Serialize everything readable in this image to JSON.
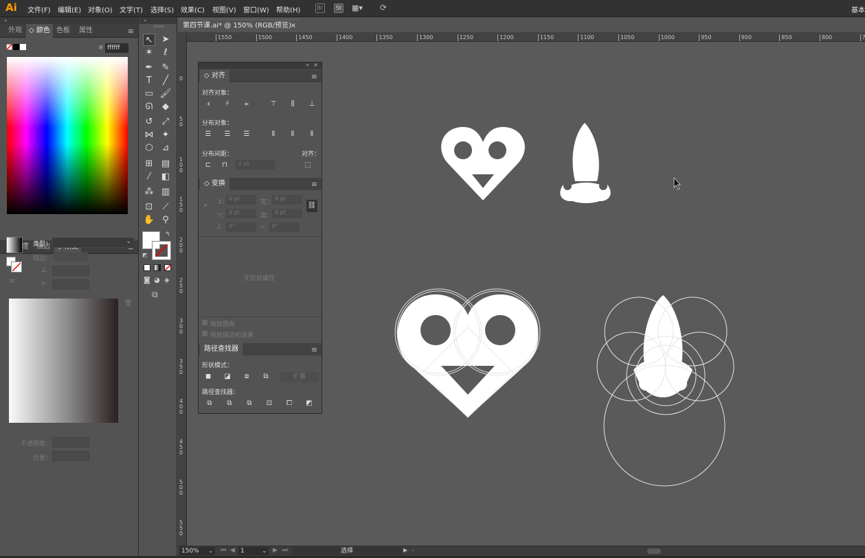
{
  "app": {
    "logo": "Ai"
  },
  "menu": [
    "文件(F)",
    "编辑(E)",
    "对象(O)",
    "文字(T)",
    "选择(S)",
    "效果(C)",
    "视图(V)",
    "窗口(W)",
    "帮助(H)"
  ],
  "menubar_icons": {
    "br": "Br",
    "st": "St"
  },
  "workspace_label": "基本",
  "left_panel": {
    "tabs_top": [
      "外观",
      "颜色",
      "色板",
      "属性"
    ],
    "active_top": "颜色",
    "hex_value": "ffffff",
    "tabs_bottom": [
      "透明度",
      "描边",
      "渐变"
    ],
    "active_bottom": "渐变",
    "gradient": {
      "type_label": "类型：",
      "stroke_label": "描边：",
      "opacity_label": "不透明度：",
      "location_label": "位置："
    }
  },
  "document": {
    "tab_title": "第四节课.ai* @ 150% (RGB/预览)",
    "close": "×"
  },
  "ruler_h": [
    "1550",
    "1500",
    "1450",
    "1400",
    "1350",
    "1300",
    "1250",
    "1200",
    "1150",
    "1100",
    "1050",
    "1000",
    "950",
    "900",
    "850",
    "800",
    "75"
  ],
  "ruler_v": [
    "0",
    "5 0",
    "1 0 0",
    "1 5 0",
    "2 0 0",
    "2 5 0",
    "3 0 0",
    "3 5 0",
    "4 0 0",
    "4 5 0",
    "5 0 0",
    "5 5 0"
  ],
  "align_panel": {
    "title": "对齐",
    "align_objects": "对齐对象：",
    "distribute_objects": "分布对象：",
    "distribute_spacing": "分布间距：",
    "align_to": "对齐：",
    "spacing_value": "0 pt"
  },
  "transform_panel": {
    "title": "变换",
    "x_label": "X：",
    "x_value": "0 pt",
    "y_label": "Y：",
    "y_value": "0 pt",
    "w_label": "宽：",
    "w_value": "0 pt",
    "h_label": "高：",
    "h_value": "0 pt",
    "angle_value": "0°",
    "shear_value": "0°",
    "no_state": "无形状属性",
    "scale_corners": "缩放圆角",
    "scale_strokes": "缩放描边和效果"
  },
  "pathfinder_panel": {
    "title": "路径查找器",
    "shape_modes": "形状模式：",
    "expand": "扩展",
    "pathfinders": "路径查找器："
  },
  "status": {
    "zoom": "150%",
    "artboard": "1",
    "tool": "选择"
  },
  "colors": {
    "accent": "#ff9a00",
    "canvas": "#5a5a5a",
    "panel": "#535353"
  }
}
